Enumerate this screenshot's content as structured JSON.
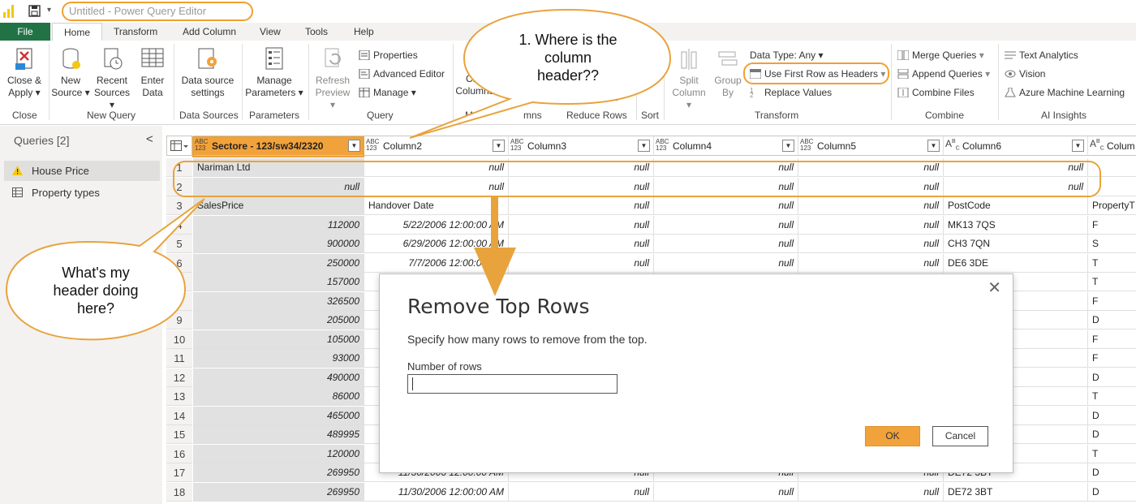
{
  "titlebar": {
    "title": "Untitled - Power Query Editor",
    "save_icon": "save-icon"
  },
  "menu": {
    "file": "File",
    "home": "Home",
    "transform": "Transform",
    "add_column": "Add Column",
    "view": "View",
    "tools": "Tools",
    "help": "Help"
  },
  "ribbon": {
    "close_apply": [
      "Close &",
      "Apply"
    ],
    "new_source": [
      "New",
      "Source"
    ],
    "recent_sources": [
      "Recent",
      "Sources"
    ],
    "enter_data": [
      "Enter",
      "Data"
    ],
    "data_source_settings": [
      "Data source",
      "settings"
    ],
    "manage_parameters": [
      "Manage",
      "Parameters"
    ],
    "refresh_preview": [
      "Refresh",
      "Preview"
    ],
    "properties": "Properties",
    "advanced_editor": "Advanced Editor",
    "manage": "Manage",
    "choose_columns": [
      "Cho",
      "Columns"
    ],
    "remove_rows_partial": "ws",
    "split_column": [
      "Split",
      "Column"
    ],
    "group_by": [
      "Group",
      "By"
    ],
    "data_type": "Data Type: Any",
    "use_first_row": "Use First Row as Headers",
    "replace_values": "Replace Values",
    "merge_queries": "Merge Queries",
    "append_queries": "Append Queries",
    "combine_files": "Combine Files",
    "text_analytics": "Text Analytics",
    "vision": "Vision",
    "azure_ml": "Azure Machine Learning",
    "groups": {
      "close": "Close",
      "new_query": "New Query",
      "data_sources": "Data Sources",
      "parameters": "Parameters",
      "query": "Query",
      "manage_columns": "Ma",
      "manage_columns_end": "mns",
      "reduce_rows": "Reduce Rows",
      "sort": "Sort",
      "transform": "Transform",
      "combine": "Combine",
      "ai_insights": "AI Insights"
    }
  },
  "queries": {
    "title": "Queries [2]",
    "items": [
      {
        "label": "House Price",
        "icon": "warning-icon"
      },
      {
        "label": "Property types",
        "icon": "table-icon"
      }
    ]
  },
  "grid": {
    "type_abc123": [
      "ABC",
      "123"
    ],
    "columns": [
      {
        "name": "Sectore - 123/sw34/2320",
        "type": "ABC123"
      },
      {
        "name": "Column2",
        "type": "ABC123"
      },
      {
        "name": "Column3",
        "type": "ABC123"
      },
      {
        "name": "Column4",
        "type": "ABC123"
      },
      {
        "name": "Column5",
        "type": "ABC123"
      },
      {
        "name": "Column6",
        "type": "ABC"
      },
      {
        "name": "Colum",
        "type": "ABC"
      }
    ],
    "rows": [
      {
        "n": "1",
        "c": [
          "Nariman Ltd",
          "null",
          "null",
          "null",
          "null",
          "null",
          ""
        ]
      },
      {
        "n": "2",
        "c": [
          "null",
          "null",
          "null",
          "null",
          "null",
          "null",
          ""
        ]
      },
      {
        "n": "3",
        "c": [
          "SalesPrice",
          "Handover Date",
          "null",
          "null",
          "null",
          "PostCode",
          "PropertyT"
        ]
      },
      {
        "n": "4",
        "c": [
          "112000",
          "5/22/2006 12:00:00 AM",
          "null",
          "null",
          "null",
          "MK13 7QS",
          "F"
        ]
      },
      {
        "n": "5",
        "c": [
          "900000",
          "6/29/2006 12:00:00 AM",
          "null",
          "null",
          "null",
          "CH3 7QN",
          "S"
        ]
      },
      {
        "n": "6",
        "c": [
          "250000",
          "7/7/2006 12:00:00 AM",
          "null",
          "null",
          "null",
          "DE6 3DE",
          "T"
        ]
      },
      {
        "n": "7",
        "c": [
          "157000",
          "",
          "",
          "",
          "",
          "",
          "T"
        ]
      },
      {
        "n": "8",
        "c": [
          "326500",
          "",
          "",
          "",
          "",
          "",
          "F"
        ]
      },
      {
        "n": "9",
        "c": [
          "205000",
          "",
          "",
          "",
          "",
          "",
          "D"
        ]
      },
      {
        "n": "10",
        "c": [
          "105000",
          "",
          "",
          "",
          "",
          "",
          "F"
        ]
      },
      {
        "n": "11",
        "c": [
          "93000",
          "",
          "",
          "",
          "",
          "",
          "F"
        ]
      },
      {
        "n": "12",
        "c": [
          "490000",
          "",
          "",
          "",
          "",
          "",
          "D"
        ]
      },
      {
        "n": "13",
        "c": [
          "86000",
          "",
          "",
          "",
          "",
          "",
          "T"
        ]
      },
      {
        "n": "14",
        "c": [
          "465000",
          "",
          "",
          "",
          "",
          "",
          "D"
        ]
      },
      {
        "n": "15",
        "c": [
          "489995",
          "",
          "",
          "",
          "",
          "",
          "D"
        ]
      },
      {
        "n": "16",
        "c": [
          "120000",
          "",
          "",
          "",
          "",
          "",
          "T"
        ]
      },
      {
        "n": "17",
        "c": [
          "269950",
          "11/30/2006 12:00:00 AM",
          "null",
          "null",
          "null",
          "DE72 3BT",
          "D"
        ]
      },
      {
        "n": "18",
        "c": [
          "269950",
          "11/30/2006 12:00:00 AM",
          "null",
          "null",
          "null",
          "DE72 3BT",
          "D"
        ]
      }
    ]
  },
  "dialog": {
    "title": "Remove Top Rows",
    "description": "Specify how many rows to remove from the top.",
    "field_label": "Number of rows",
    "field_value": "",
    "ok": "OK",
    "cancel": "Cancel"
  },
  "callouts": {
    "top": [
      "1. Where is the",
      "column",
      "header??"
    ],
    "left": [
      "What's my",
      "header doing",
      "here?"
    ]
  },
  "colors": {
    "accent_orange": "#f2a23a",
    "file_tab": "#217346",
    "callout_border": "#e8a33d"
  }
}
